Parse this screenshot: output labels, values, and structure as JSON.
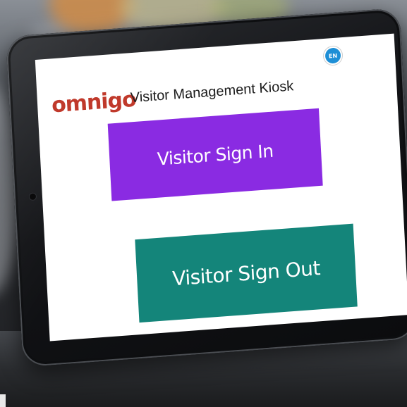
{
  "app": {
    "brand": "omnigo",
    "title": "Visitor Management Kiosk"
  },
  "language": {
    "code": "EN"
  },
  "actions": {
    "sign_in_label": "Visitor Sign In",
    "sign_out_label": "Visitor Sign Out"
  },
  "colors": {
    "brand": "#c0392b",
    "sign_in": "#8a2be2",
    "sign_out": "#14857a",
    "language_badge": "#1e8fd6"
  }
}
